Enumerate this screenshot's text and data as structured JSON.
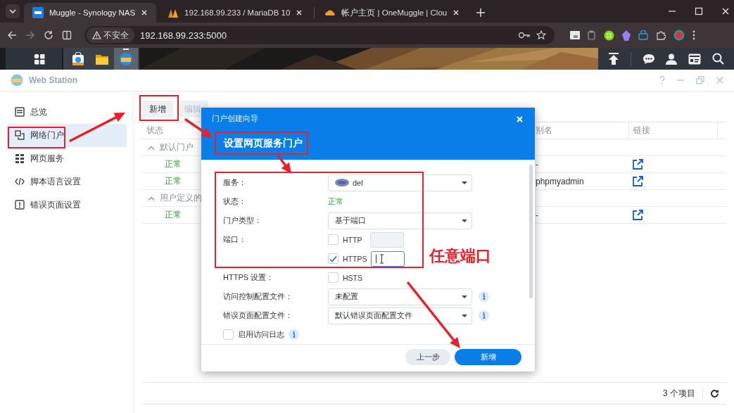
{
  "browser": {
    "tabs": [
      {
        "title": "Muggle - Synology NAS",
        "selected": true
      },
      {
        "title": "192.168.99.233 / MariaDB 10",
        "selected": false
      },
      {
        "title": "帐户主页 | OneMuggle | Clou",
        "selected": false
      }
    ],
    "security": "不安全",
    "url": "192.168.99.233:5000"
  },
  "taskbar": {
    "apps": [
      {
        "kind": "package",
        "selected": false
      },
      {
        "kind": "folder",
        "selected": false
      },
      {
        "kind": "web",
        "selected": true
      }
    ]
  },
  "window": {
    "title": "Web Station"
  },
  "sidebar": {
    "items": [
      {
        "label": "总览",
        "selected": false
      },
      {
        "label": "网络门户",
        "selected": true
      },
      {
        "label": "网页服务",
        "selected": false
      },
      {
        "label": "脚本语言设置",
        "selected": false
      },
      {
        "label": "错误页面设置",
        "selected": false
      }
    ]
  },
  "toolbar": {
    "buttons": [
      {
        "label": "新增",
        "disabled": false
      },
      {
        "label": "编辑",
        "disabled": true
      }
    ]
  },
  "table": {
    "columns": [
      "状态",
      "别名",
      "链接"
    ],
    "groups": [
      {
        "label": "默认门户",
        "expanded": true,
        "rows": [
          {
            "status": "正常",
            "alias": "-"
          },
          {
            "status": "正常",
            "alias": "phpmyadmin"
          }
        ]
      },
      {
        "label": "用户定义的",
        "expanded": true,
        "rows": [
          {
            "status": "正常",
            "alias": "-"
          }
        ]
      }
    ]
  },
  "footer": {
    "count": "3 个项目"
  },
  "dialog": {
    "title": "门户创建向导",
    "heading": "设置网页服务门户",
    "fields": [
      {
        "kind": "select",
        "label": "服务：",
        "value": "del",
        "logo": true
      },
      {
        "kind": "status",
        "label": "状态：",
        "value": "正常"
      },
      {
        "kind": "select",
        "label": "门户类型：",
        "value": "基于端口"
      },
      {
        "kind": "port",
        "label": "端口：",
        "option": "HTTP",
        "checked": false,
        "focused": false
      },
      {
        "kind": "port",
        "option": "HTTPS",
        "checked": true,
        "focused": true
      },
      {
        "kind": "checkbox",
        "label": "HTTPS 设置：",
        "option": "HSTS",
        "checked": false
      },
      {
        "kind": "select",
        "label": "访问控制配置文件：",
        "value": "未配置",
        "info": true
      },
      {
        "kind": "select",
        "label": "错误页面配置文件：",
        "value": "默认错误页面配置文件",
        "info": true
      },
      {
        "kind": "check-only",
        "option": "启用访问日志",
        "checked": false,
        "info": true
      }
    ],
    "buttons": [
      {
        "label": "上一步",
        "kind": "secondary"
      },
      {
        "label": "新增",
        "kind": "primary"
      }
    ]
  },
  "annotation": {
    "text": "任意端口"
  }
}
